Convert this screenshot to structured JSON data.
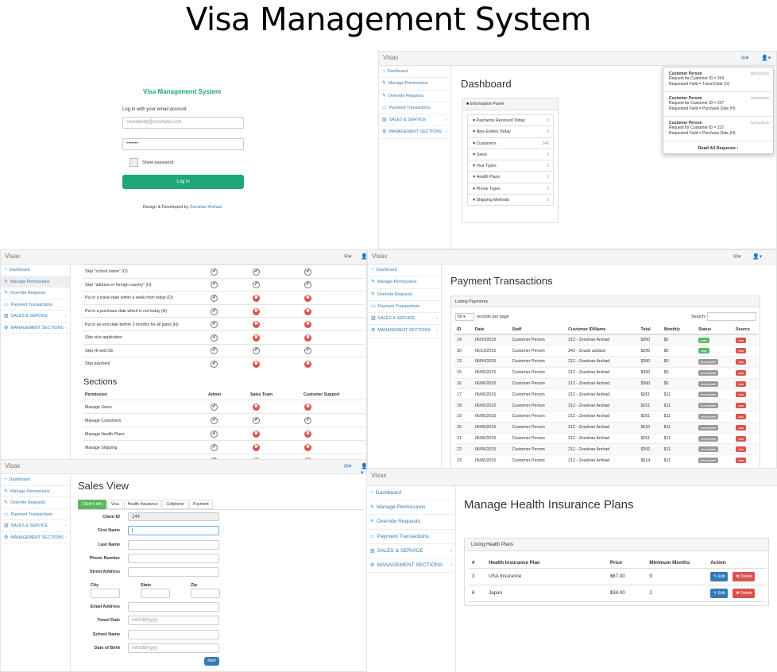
{
  "title": "Visa Management System",
  "brand": "Visax",
  "icons": {
    "envelope": "envelope-icon",
    "user": "user-icon"
  },
  "colors": {
    "green": "#1fa67a",
    "red": "#d9534f",
    "blue": "#337ab7",
    "success": "#5cb85c",
    "gray": "#999999"
  },
  "sidebar_items": [
    {
      "label": "Dashboard",
      "icon": "dashboard-icon"
    },
    {
      "label": "Manage Permissions",
      "icon": "wrench-icon"
    },
    {
      "label": "Override Requests",
      "icon": "wrench-icon"
    },
    {
      "label": "Payment Transactions",
      "icon": "card-icon"
    },
    {
      "label": "SALES & SERVICE",
      "icon": "chart-icon"
    },
    {
      "label": "MANAGEMENT SECTIONS",
      "icon": "gear-icon"
    }
  ],
  "login": {
    "heading": "Visa Management System",
    "instruction": "Log in with your email account",
    "email_placeholder": "somebody@example.com",
    "password_value": "•••••••",
    "show_password": "Show password",
    "login_button": "Log in",
    "credit_prefix": "Design & Developed by ",
    "credit_name": "Zeeshan Arshad"
  },
  "dashboard": {
    "heading": "Dashboard",
    "panel_title": "Information Panel",
    "items": [
      {
        "label": "Payments Received Today",
        "count": "0"
      },
      {
        "label": "New Entries Today",
        "count": "0"
      },
      {
        "label": "Customers",
        "count": "246"
      },
      {
        "label": "Users",
        "count": "3"
      },
      {
        "label": "Visa Types",
        "count": "3"
      },
      {
        "label": "Health Plans",
        "count": "3"
      },
      {
        "label": "Phone Types",
        "count": "2"
      },
      {
        "label": "Shipping Methods",
        "count": "3"
      }
    ],
    "notifications": [
      {
        "name": "Customer Person",
        "date": "06/13/2015",
        "line1": "Request for Customer ID = 243",
        "line2": "Requested Field = Travel Date (O)"
      },
      {
        "name": "Customer Person",
        "date": "06/31/2015",
        "line1": "Request for Customer ID = 227",
        "line2": "Requested Field = Purchase Date (H)"
      },
      {
        "name": "Customer Person",
        "date": "06/31/2015",
        "line1": "Request for Customer ID = 227",
        "line2": "Requested Field = Purchase Date (H)"
      }
    ],
    "read_all": "Read All Requests ›"
  },
  "permissions": {
    "rules": [
      {
        "label": "Skip \"school name\" (O)",
        "cols": [
          "c",
          "c",
          "c"
        ]
      },
      {
        "label": "Skip \"address in foreign country\" (H)",
        "cols": [
          "c",
          "c",
          "c"
        ]
      },
      {
        "label": "Put in a travel date within a week from today (O)",
        "cols": [
          "c",
          "x",
          "x"
        ]
      },
      {
        "label": "Put in a purchase date which is not today (H)",
        "cols": [
          "c",
          "x",
          "x"
        ]
      },
      {
        "label": "Put in an end date before 3 months for all plans (H)",
        "cols": [
          "c",
          "x",
          "x"
        ]
      },
      {
        "label": "Skip visa application",
        "cols": [
          "c",
          "x",
          "x"
        ]
      },
      {
        "label": "Skip HI and CE",
        "cols": [
          "c",
          "c",
          "c"
        ]
      },
      {
        "label": "Skip payment",
        "cols": [
          "c",
          "x",
          "x"
        ]
      }
    ],
    "sections_heading": "Sections",
    "headers": [
      "Permission",
      "Admin",
      "Sales Team",
      "Customer Support"
    ],
    "sections": [
      {
        "label": "Manage Users",
        "cols": [
          "c",
          "x",
          "x"
        ]
      },
      {
        "label": "Manage Customers",
        "cols": [
          "c",
          "c",
          "c"
        ]
      },
      {
        "label": "Manage Health Plans",
        "cols": [
          "c",
          "x",
          "x"
        ]
      },
      {
        "label": "Manage Shipping",
        "cols": [
          "c",
          "x",
          "x"
        ]
      },
      {
        "label": "Manage Phone Types",
        "cols": [
          "c",
          "x",
          "x"
        ]
      }
    ]
  },
  "payments": {
    "heading": "Payment Transactions",
    "panel_title": "Listing Payments",
    "page_size": "50",
    "records_label": "records per page",
    "search_label": "Search:",
    "headers": [
      "ID",
      "Date",
      "Staff",
      "Customer ID/Name",
      "Total",
      "Monthly",
      "Status",
      "Source"
    ],
    "rows": [
      [
        "14",
        "06/03/2015",
        "Customer Person",
        "212 - Zeeshan Arshad",
        "$360",
        "$0",
        "paid",
        "visa"
      ],
      [
        "30",
        "06/13/2015",
        "Customer Person",
        "243 - Zeads asdasd",
        "$250",
        "$0",
        "paid",
        "visa"
      ],
      [
        "13",
        "06/04/2015",
        "Customer Person",
        "212 - Zeeshan Arshad",
        "$360",
        "$0",
        "incomplete",
        "visa"
      ],
      [
        "15",
        "06/06/2015",
        "Customer Person",
        "212 - Zeeshan Arshad",
        "$360",
        "$0",
        "incomplete",
        "visa"
      ],
      [
        "16",
        "06/06/2015",
        "Customer Person",
        "212 - Zeeshan Arshad",
        "$360",
        "$0",
        "incomplete",
        "visa"
      ],
      [
        "17",
        "06/06/2015",
        "Customer Person",
        "212 - Zeeshan Arshad",
        "$261",
        "$11",
        "incomplete",
        "visa"
      ],
      [
        "18",
        "06/06/2015",
        "Customer Person",
        "212 - Zeeshan Arshad",
        "$261",
        "$11",
        "incomplete",
        "visa"
      ],
      [
        "19",
        "06/06/2015",
        "Customer Person",
        "212 - Zeeshan Arshad",
        "$261",
        "$11",
        "incomplete",
        "visa"
      ],
      [
        "20",
        "06/06/2015",
        "Customer Person",
        "212 - Zeeshan Arshad",
        "$510",
        "$11",
        "incomplete",
        "visa"
      ],
      [
        "21",
        "06/06/2015",
        "Customer Person",
        "212 - Zeeshan Arshad",
        "$261",
        "$11",
        "incomplete",
        "visa"
      ],
      [
        "22",
        "06/06/2015",
        "Customer Person",
        "212 - Zeeshan Arshad",
        "$392",
        "$11",
        "incomplete",
        "visa"
      ],
      [
        "23",
        "06/06/2015",
        "Customer Person",
        "212 - Zeeshan Arshad",
        "$514",
        "$11",
        "incomplete",
        "visa"
      ]
    ]
  },
  "sales": {
    "heading": "Sales View",
    "tabs": [
      "Client's Info",
      "Visa",
      "Health Insurance",
      "Cellphone",
      "Payment"
    ],
    "fields": {
      "client_id_label": "Client ID",
      "client_id_value": "244",
      "first_name": "First Name",
      "last_name": "Last Name",
      "phone": "Phone Number",
      "street": "Street Address",
      "city": "City",
      "state": "State",
      "zip": "Zip",
      "email": "Email Address",
      "travel_date": "Travel Date",
      "school": "School Name",
      "dob": "Date of Birth",
      "date_placeholder": "mm/dd/yyyy"
    },
    "next": "Next"
  },
  "health": {
    "heading": "Manage Health Insurance Plans",
    "panel_title": "Listing Health Plans",
    "headers": [
      "#",
      "Health Insurance Plan",
      "Price",
      "Minimum Months",
      "Action"
    ],
    "rows": [
      {
        "id": "3",
        "plan": "USA Insurance",
        "price": "$67.00",
        "min": "9"
      },
      {
        "id": "6",
        "plan": "Japan",
        "price": "$34.00",
        "min": "2"
      }
    ],
    "edit": "Edit",
    "delete": "Delete"
  }
}
